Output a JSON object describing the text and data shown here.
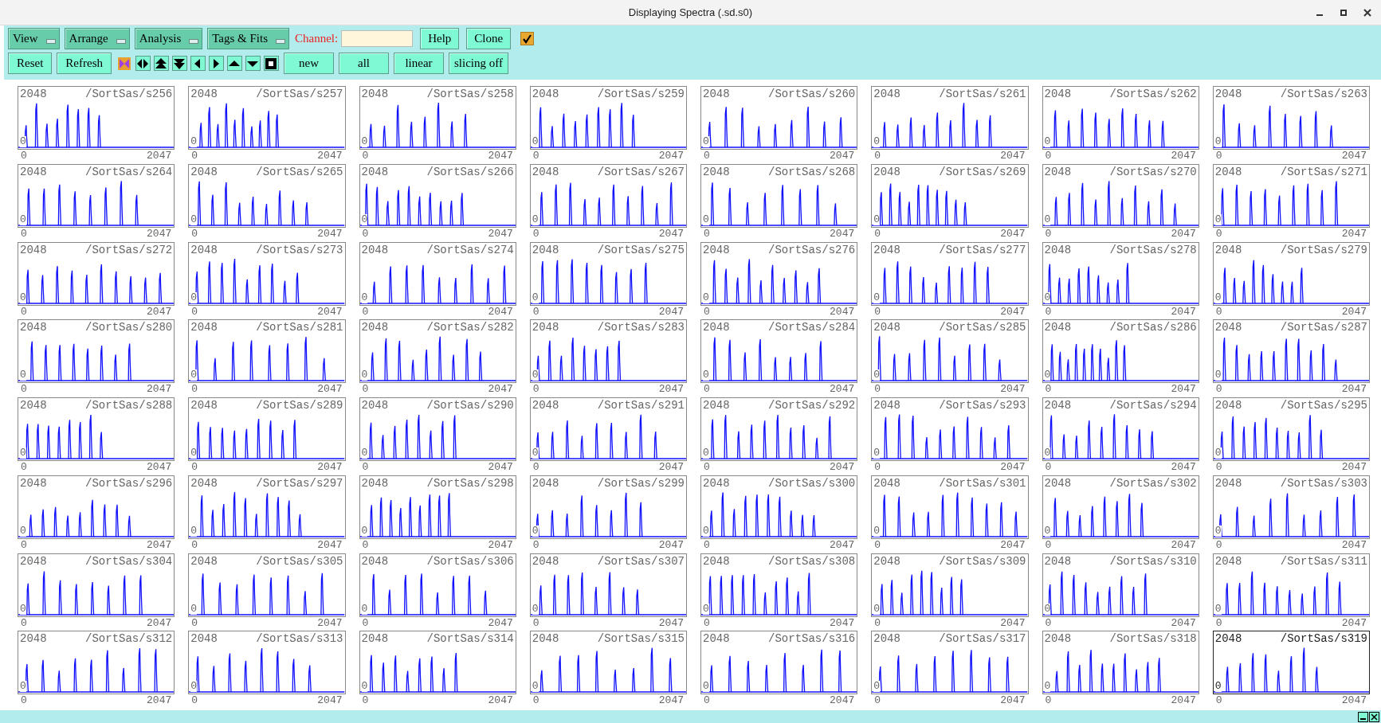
{
  "window": {
    "title": "Displaying Spectra (.sd.s0)"
  },
  "toolbar": {
    "menus": [
      "View",
      "Arrange",
      "Analysis",
      "Tags & Fits"
    ],
    "channel_label": "Channel:",
    "buttons": [
      "Help",
      "Clone"
    ],
    "checkbox": {
      "checked": true
    },
    "buttons_row2": [
      "Reset",
      "Refresh"
    ],
    "icon_buttons": [
      {
        "kind": "shrink"
      },
      {
        "kind": "leftright"
      },
      {
        "kind": "dblup"
      },
      {
        "kind": "dbldown"
      },
      {
        "kind": "left"
      },
      {
        "kind": "right"
      },
      {
        "kind": "up"
      },
      {
        "kind": "down"
      },
      {
        "kind": "square"
      }
    ],
    "toggles": [
      "new",
      "all",
      "linear",
      "slicing off"
    ]
  },
  "spectra": [
    {
      "name": "/SortSas/s256",
      "ymax": "2048",
      "ymin": "0",
      "xmin": "0",
      "xmax": "2047",
      "selected": false
    },
    {
      "name": "/SortSas/s257",
      "ymax": "2048",
      "ymin": "0",
      "xmin": "0",
      "xmax": "2047",
      "selected": false
    },
    {
      "name": "/SortSas/s258",
      "ymax": "2048",
      "ymin": "0",
      "xmin": "0",
      "xmax": "2047",
      "selected": false
    },
    {
      "name": "/SortSas/s259",
      "ymax": "2048",
      "ymin": "0",
      "xmin": "0",
      "xmax": "2047",
      "selected": false
    },
    {
      "name": "/SortSas/s260",
      "ymax": "2048",
      "ymin": "0",
      "xmin": "0",
      "xmax": "2047",
      "selected": false
    },
    {
      "name": "/SortSas/s261",
      "ymax": "2048",
      "ymin": "0",
      "xmin": "0",
      "xmax": "2047",
      "selected": false
    },
    {
      "name": "/SortSas/s262",
      "ymax": "2048",
      "ymin": "0",
      "xmin": "0",
      "xmax": "2047",
      "selected": false
    },
    {
      "name": "/SortSas/s263",
      "ymax": "2048",
      "ymin": "0",
      "xmin": "0",
      "xmax": "2047",
      "selected": false
    },
    {
      "name": "/SortSas/s264",
      "ymax": "2048",
      "ymin": "0",
      "xmin": "0",
      "xmax": "2047",
      "selected": false
    },
    {
      "name": "/SortSas/s265",
      "ymax": "2048",
      "ymin": "0",
      "xmin": "0",
      "xmax": "2047",
      "selected": false
    },
    {
      "name": "/SortSas/s266",
      "ymax": "2048",
      "ymin": "0",
      "xmin": "0",
      "xmax": "2047",
      "selected": false
    },
    {
      "name": "/SortSas/s267",
      "ymax": "2048",
      "ymin": "0",
      "xmin": "0",
      "xmax": "2047",
      "selected": false
    },
    {
      "name": "/SortSas/s268",
      "ymax": "2048",
      "ymin": "0",
      "xmin": "0",
      "xmax": "2047",
      "selected": false
    },
    {
      "name": "/SortSas/s269",
      "ymax": "2048",
      "ymin": "0",
      "xmin": "0",
      "xmax": "2047",
      "selected": false
    },
    {
      "name": "/SortSas/s270",
      "ymax": "2048",
      "ymin": "0",
      "xmin": "0",
      "xmax": "2047",
      "selected": false
    },
    {
      "name": "/SortSas/s271",
      "ymax": "2048",
      "ymin": "0",
      "xmin": "0",
      "xmax": "2047",
      "selected": false
    },
    {
      "name": "/SortSas/s272",
      "ymax": "2048",
      "ymin": "0",
      "xmin": "0",
      "xmax": "2047",
      "selected": false
    },
    {
      "name": "/SortSas/s273",
      "ymax": "2048",
      "ymin": "0",
      "xmin": "0",
      "xmax": "2047",
      "selected": false
    },
    {
      "name": "/SortSas/s274",
      "ymax": "2048",
      "ymin": "0",
      "xmin": "0",
      "xmax": "2047",
      "selected": false
    },
    {
      "name": "/SortSas/s275",
      "ymax": "2048",
      "ymin": "0",
      "xmin": "0",
      "xmax": "2047",
      "selected": false
    },
    {
      "name": "/SortSas/s276",
      "ymax": "2048",
      "ymin": "0",
      "xmin": "0",
      "xmax": "2047",
      "selected": false
    },
    {
      "name": "/SortSas/s277",
      "ymax": "2048",
      "ymin": "0",
      "xmin": "0",
      "xmax": "2047",
      "selected": false
    },
    {
      "name": "/SortSas/s278",
      "ymax": "2048",
      "ymin": "0",
      "xmin": "0",
      "xmax": "2047",
      "selected": false
    },
    {
      "name": "/SortSas/s279",
      "ymax": "2048",
      "ymin": "0",
      "xmin": "0",
      "xmax": "2047",
      "selected": false
    },
    {
      "name": "/SortSas/s280",
      "ymax": "2048",
      "ymin": "0",
      "xmin": "0",
      "xmax": "2047",
      "selected": false
    },
    {
      "name": "/SortSas/s281",
      "ymax": "2048",
      "ymin": "0",
      "xmin": "0",
      "xmax": "2047",
      "selected": false
    },
    {
      "name": "/SortSas/s282",
      "ymax": "2048",
      "ymin": "0",
      "xmin": "0",
      "xmax": "2047",
      "selected": false
    },
    {
      "name": "/SortSas/s283",
      "ymax": "2048",
      "ymin": "0",
      "xmin": "0",
      "xmax": "2047",
      "selected": false
    },
    {
      "name": "/SortSas/s284",
      "ymax": "2048",
      "ymin": "0",
      "xmin": "0",
      "xmax": "2047",
      "selected": false
    },
    {
      "name": "/SortSas/s285",
      "ymax": "2048",
      "ymin": "0",
      "xmin": "0",
      "xmax": "2047",
      "selected": false
    },
    {
      "name": "/SortSas/s286",
      "ymax": "2048",
      "ymin": "0",
      "xmin": "0",
      "xmax": "2047",
      "selected": false
    },
    {
      "name": "/SortSas/s287",
      "ymax": "2048",
      "ymin": "0",
      "xmin": "0",
      "xmax": "2047",
      "selected": false
    },
    {
      "name": "/SortSas/s288",
      "ymax": "2048",
      "ymin": "0",
      "xmin": "0",
      "xmax": "2047",
      "selected": false
    },
    {
      "name": "/SortSas/s289",
      "ymax": "2048",
      "ymin": "0",
      "xmin": "0",
      "xmax": "2047",
      "selected": false
    },
    {
      "name": "/SortSas/s290",
      "ymax": "2048",
      "ymin": "0",
      "xmin": "0",
      "xmax": "2047",
      "selected": false
    },
    {
      "name": "/SortSas/s291",
      "ymax": "2048",
      "ymin": "0",
      "xmin": "0",
      "xmax": "2047",
      "selected": false
    },
    {
      "name": "/SortSas/s292",
      "ymax": "2048",
      "ymin": "0",
      "xmin": "0",
      "xmax": "2047",
      "selected": false
    },
    {
      "name": "/SortSas/s293",
      "ymax": "2048",
      "ymin": "0",
      "xmin": "0",
      "xmax": "2047",
      "selected": false
    },
    {
      "name": "/SortSas/s294",
      "ymax": "2048",
      "ymin": "0",
      "xmin": "0",
      "xmax": "2047",
      "selected": false
    },
    {
      "name": "/SortSas/s295",
      "ymax": "2048",
      "ymin": "0",
      "xmin": "0",
      "xmax": "2047",
      "selected": false
    },
    {
      "name": "/SortSas/s296",
      "ymax": "2048",
      "ymin": "0",
      "xmin": "0",
      "xmax": "2047",
      "selected": false
    },
    {
      "name": "/SortSas/s297",
      "ymax": "2048",
      "ymin": "0",
      "xmin": "0",
      "xmax": "2047",
      "selected": false
    },
    {
      "name": "/SortSas/s298",
      "ymax": "2048",
      "ymin": "0",
      "xmin": "0",
      "xmax": "2047",
      "selected": false
    },
    {
      "name": "/SortSas/s299",
      "ymax": "2048",
      "ymin": "0",
      "xmin": "0",
      "xmax": "2047",
      "selected": false
    },
    {
      "name": "/SortSas/s300",
      "ymax": "2048",
      "ymin": "0",
      "xmin": "0",
      "xmax": "2047",
      "selected": false
    },
    {
      "name": "/SortSas/s301",
      "ymax": "2048",
      "ymin": "0",
      "xmin": "0",
      "xmax": "2047",
      "selected": false
    },
    {
      "name": "/SortSas/s302",
      "ymax": "2048",
      "ymin": "0",
      "xmin": "0",
      "xmax": "2047",
      "selected": false
    },
    {
      "name": "/SortSas/s303",
      "ymax": "2048",
      "ymin": "0",
      "xmin": "0",
      "xmax": "2047",
      "selected": false
    },
    {
      "name": "/SortSas/s304",
      "ymax": "2048",
      "ymin": "0",
      "xmin": "0",
      "xmax": "2047",
      "selected": false
    },
    {
      "name": "/SortSas/s305",
      "ymax": "2048",
      "ymin": "0",
      "xmin": "0",
      "xmax": "2047",
      "selected": false
    },
    {
      "name": "/SortSas/s306",
      "ymax": "2048",
      "ymin": "0",
      "xmin": "0",
      "xmax": "2047",
      "selected": false
    },
    {
      "name": "/SortSas/s307",
      "ymax": "2048",
      "ymin": "0",
      "xmin": "0",
      "xmax": "2047",
      "selected": false
    },
    {
      "name": "/SortSas/s308",
      "ymax": "2048",
      "ymin": "0",
      "xmin": "0",
      "xmax": "2047",
      "selected": false
    },
    {
      "name": "/SortSas/s309",
      "ymax": "2048",
      "ymin": "0",
      "xmin": "0",
      "xmax": "2047",
      "selected": false
    },
    {
      "name": "/SortSas/s310",
      "ymax": "2048",
      "ymin": "0",
      "xmin": "0",
      "xmax": "2047",
      "selected": false
    },
    {
      "name": "/SortSas/s311",
      "ymax": "2048",
      "ymin": "0",
      "xmin": "0",
      "xmax": "2047",
      "selected": false
    },
    {
      "name": "/SortSas/s312",
      "ymax": "2048",
      "ymin": "0",
      "xmin": "0",
      "xmax": "2047",
      "selected": false
    },
    {
      "name": "/SortSas/s313",
      "ymax": "2048",
      "ymin": "0",
      "xmin": "0",
      "xmax": "2047",
      "selected": false
    },
    {
      "name": "/SortSas/s314",
      "ymax": "2048",
      "ymin": "0",
      "xmin": "0",
      "xmax": "2047",
      "selected": false
    },
    {
      "name": "/SortSas/s315",
      "ymax": "2048",
      "ymin": "0",
      "xmin": "0",
      "xmax": "2047",
      "selected": false
    },
    {
      "name": "/SortSas/s316",
      "ymax": "2048",
      "ymin": "0",
      "xmin": "0",
      "xmax": "2047",
      "selected": false
    },
    {
      "name": "/SortSas/s317",
      "ymax": "2048",
      "ymin": "0",
      "xmin": "0",
      "xmax": "2047",
      "selected": false
    },
    {
      "name": "/SortSas/s318",
      "ymax": "2048",
      "ymin": "0",
      "xmin": "0",
      "xmax": "2047",
      "selected": false
    },
    {
      "name": "/SortSas/s319",
      "ymax": "2048",
      "ymin": "0",
      "xmin": "0",
      "xmax": "2047",
      "selected": true
    }
  ]
}
